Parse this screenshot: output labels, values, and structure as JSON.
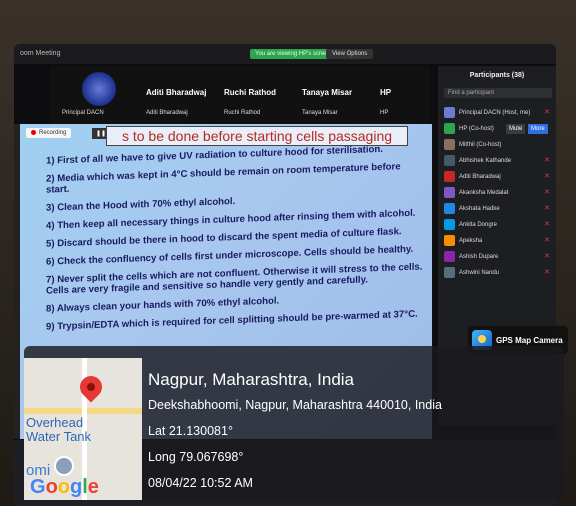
{
  "window": {
    "title": "oom Meeting"
  },
  "banner": {
    "viewing_text": "You are viewing HP's screen",
    "view_options": "View Options"
  },
  "gallery": {
    "host_name": "Principal DACN",
    "tiles": [
      {
        "name": "Aditi Bharadwaj",
        "sub": "Aditi Bharadwaj"
      },
      {
        "name": "Ruchi Rathod",
        "sub": "Ruchi Rathod"
      },
      {
        "name": "Tanaya Misar",
        "sub": "Tanaya Misar"
      },
      {
        "name": "HP",
        "sub": "HP"
      }
    ],
    "next_icon": "chevron-right-icon"
  },
  "slide": {
    "recording": "Recording",
    "title": "s to be done before starting cells passaging",
    "steps": [
      "1)  First of all we have to give UV radiation to culture hood for sterilisation.",
      "2)  Media which was kept in 4°C should be remain on room temperature before start.",
      "3)  Clean the Hood with 70% ethyl alcohol.",
      "4)  Then keep all necessary things in culture hood after rinsing them with alcohol.",
      "5)  Discard should be there in hood to discard the spent media of culture flask.",
      "6)  Check the confluency of cells first under microscope. Cells should be healthy.",
      "7)  Never split the cells which are not confluent. Otherwise it will stress to the cells. Cells are very fragile and sensitive so handle very gently and carefully.",
      "8)  Always clean your hands with 70% ethyl alcohol.",
      "9)  Trypsin/EDTA which is required for cell splitting should be pre-warmed at 37°C."
    ]
  },
  "participants": {
    "header": "Participants (38)",
    "search_placeholder": "Find a participant",
    "mute_label": "Mute",
    "more_label": "More",
    "rows": [
      {
        "initials": "",
        "name": "Principal DACN (Host, me)",
        "color": "#6b7bd6"
      },
      {
        "initials": "H",
        "name": "HP (Co-host)",
        "color": "#2da44e"
      },
      {
        "initials": "M",
        "name": "Mitthil (Co-host)",
        "color": "#8d6e63"
      },
      {
        "initials": "A",
        "name": "Abhishek Kathande",
        "color": "#455a64"
      },
      {
        "initials": "AB",
        "name": "Aditi Bharadwaj",
        "color": "#c62828"
      },
      {
        "initials": "A",
        "name": "Akanksha Medalat",
        "color": "#7e57c2"
      },
      {
        "initials": "AH",
        "name": "Akshata Hadke",
        "color": "#1e88e5"
      },
      {
        "initials": "A",
        "name": "Ankita Dongre",
        "color": "#039be5"
      },
      {
        "initials": "A",
        "name": "Apeksha",
        "color": "#fb8c00"
      },
      {
        "initials": "A",
        "name": "Ashish Dupare",
        "color": "#8e24aa"
      },
      {
        "initials": "A",
        "name": "Ashwini Nandu",
        "color": "#546e7a"
      }
    ]
  },
  "geotag": {
    "city": "Nagpur, Maharashtra, India",
    "address": "Deekshabhoomi, Nagpur, Maharashtra 440010, India",
    "lat": "Lat 21.130081°",
    "long": "Long 79.067698°",
    "datetime": "08/04/22 10:52 AM",
    "map_label_1": "Overhead",
    "map_label_2": "Water Tank",
    "map_label_3": "omi",
    "google_letters": [
      "G",
      "o",
      "o",
      "g",
      "l",
      "e"
    ],
    "app_name": "GPS Map Camera"
  }
}
